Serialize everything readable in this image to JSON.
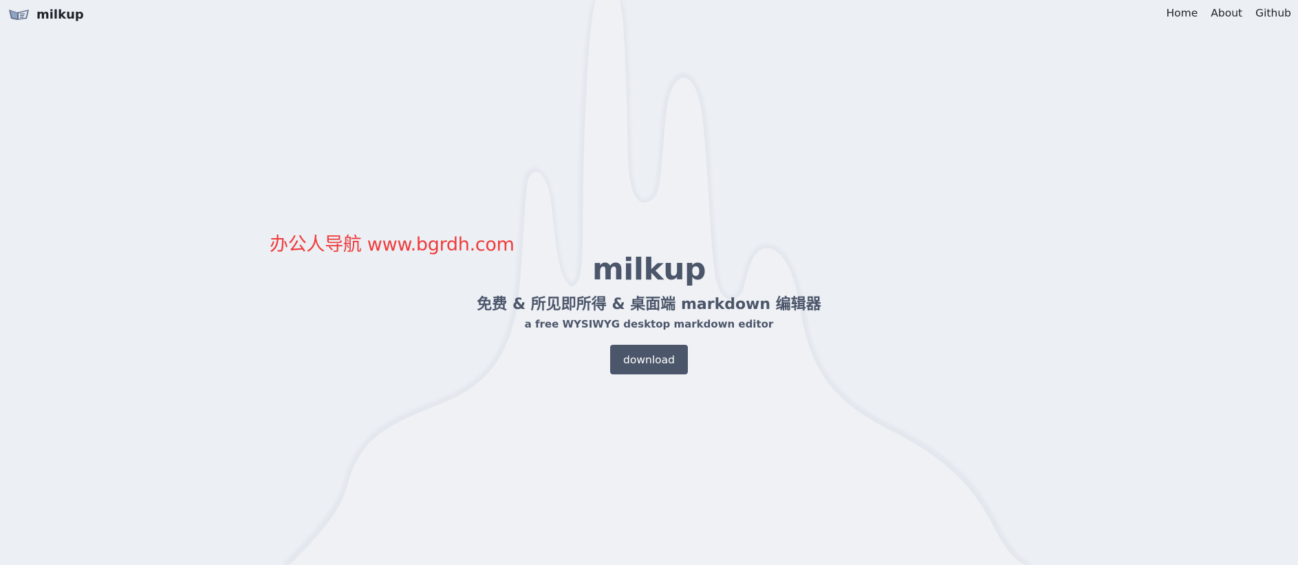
{
  "header": {
    "brand_name": "milkup",
    "logo_icon": "milkup-logo-icon",
    "nav": [
      {
        "label": "Home"
      },
      {
        "label": "About"
      },
      {
        "label": "Github"
      }
    ]
  },
  "watermark": {
    "text": "办公人导航 www.bgrdh.com",
    "color": "#ef3b3b"
  },
  "hero": {
    "title": "milkup",
    "subtitle": "免费 & 所见即所得 & 桌面端 markdown 编辑器",
    "description": "a free WYSIWYG desktop markdown editor",
    "download_label": "download"
  },
  "colors": {
    "background": "#eceff4",
    "accent": "#4c566a",
    "text_dark": "#1e2329"
  }
}
